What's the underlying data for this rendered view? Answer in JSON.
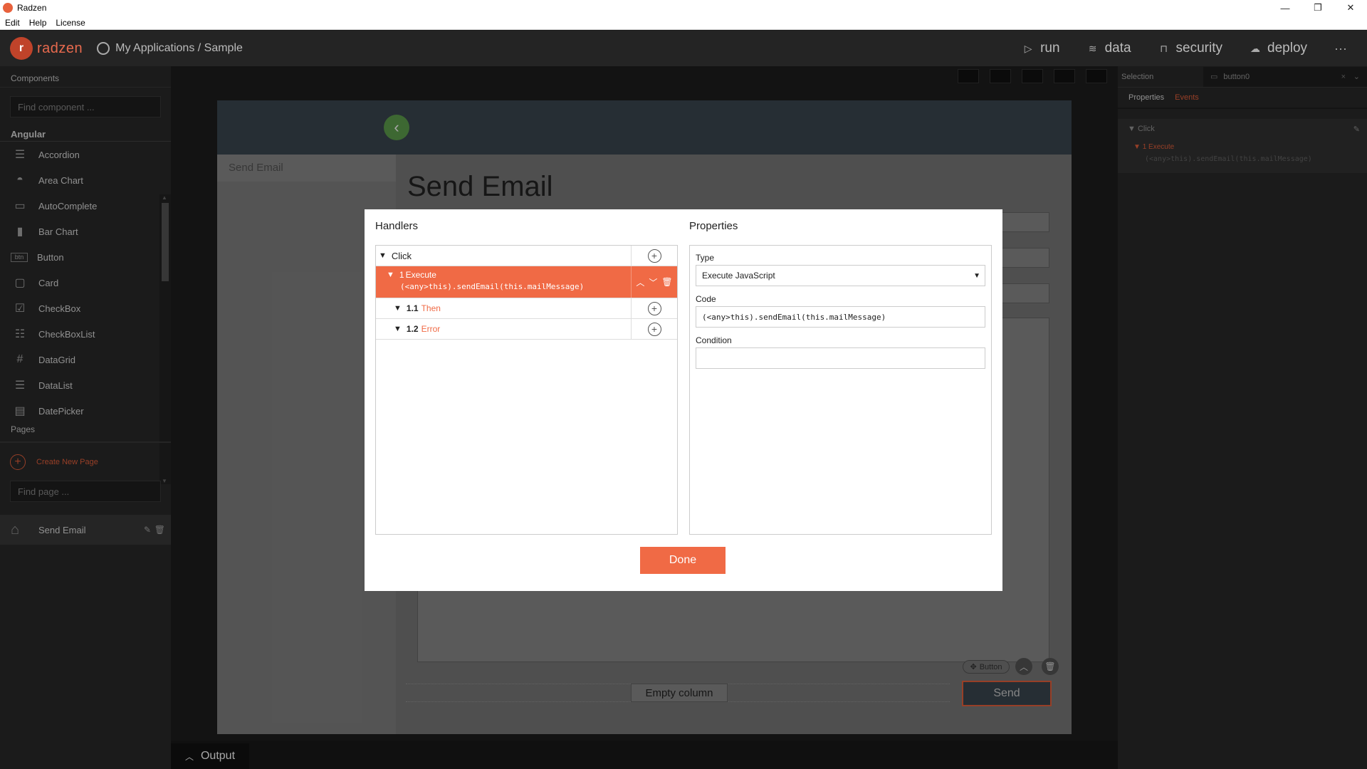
{
  "window": {
    "title": "Radzen",
    "min_icon": "minimize-icon",
    "max_icon": "restore-icon",
    "close_icon": "close-icon"
  },
  "menu": [
    "Edit",
    "Help",
    "License"
  ],
  "header": {
    "brand": "radzen",
    "breadcrumb": "My Applications / Sample",
    "nav": [
      {
        "label": "run",
        "icon": "play-icon"
      },
      {
        "label": "data",
        "icon": "layers-icon"
      },
      {
        "label": "security",
        "icon": "lock-icon"
      },
      {
        "label": "deploy",
        "icon": "cloud-upload-icon"
      }
    ],
    "more": "···"
  },
  "left": {
    "components_title": "Components",
    "find_component_placeholder": "Find component ...",
    "group": "Angular",
    "components": [
      {
        "label": "Accordion",
        "icon": "accordion-icon",
        "glyph": "☰"
      },
      {
        "label": "Area Chart",
        "icon": "area-chart-icon",
        "glyph": "◓"
      },
      {
        "label": "AutoComplete",
        "icon": "autocomplete-icon",
        "glyph": "▭"
      },
      {
        "label": "Bar Chart",
        "icon": "bar-chart-icon",
        "glyph": "▮"
      },
      {
        "label": "Button",
        "icon": "button-icon",
        "glyph": "btn"
      },
      {
        "label": "Card",
        "icon": "card-icon",
        "glyph": "▢"
      },
      {
        "label": "CheckBox",
        "icon": "checkbox-icon",
        "glyph": "☑"
      },
      {
        "label": "CheckBoxList",
        "icon": "checkboxlist-icon",
        "glyph": "☷"
      },
      {
        "label": "DataGrid",
        "icon": "datagrid-icon",
        "glyph": "#"
      },
      {
        "label": "DataList",
        "icon": "datalist-icon",
        "glyph": "☰"
      },
      {
        "label": "DatePicker",
        "icon": "datepicker-icon",
        "glyph": "▤"
      }
    ],
    "pages_title": "Pages",
    "create_page": "Create New Page",
    "find_page_placeholder": "Find page ...",
    "pages": [
      {
        "label": "Send Email"
      }
    ]
  },
  "canvas": {
    "side_item": "Send Email",
    "page_title": "Send Email",
    "empty_column": "Empty column",
    "send_button": "Send",
    "button_tag": "Button"
  },
  "right": {
    "selection_label": "Selection",
    "selection_value": "button0",
    "tabs": [
      "Properties",
      "Events"
    ],
    "event_name": "Click",
    "event_action": "1 Execute",
    "event_code": "(<any>this).sendEmail(this.mailMessage)"
  },
  "output_label": "Output",
  "dialog": {
    "handlers_title": "Handlers",
    "properties_title": "Properties",
    "tree": {
      "root": "Click",
      "action_num": "1",
      "action": "Execute",
      "action_code": "(<any>this).sendEmail(this.mailMessage)",
      "then_num": "1.1",
      "then": "Then",
      "error_num": "1.2",
      "error": "Error"
    },
    "type_label": "Type",
    "type_value": "Execute JavaScript",
    "code_label": "Code",
    "code_value": "(<any>this).sendEmail(this.mailMessage)",
    "condition_label": "Condition",
    "condition_value": "",
    "done": "Done"
  },
  "colors": {
    "accent": "#f06a45",
    "brand": "#e86a4e",
    "back_button": "#5fa04e"
  }
}
